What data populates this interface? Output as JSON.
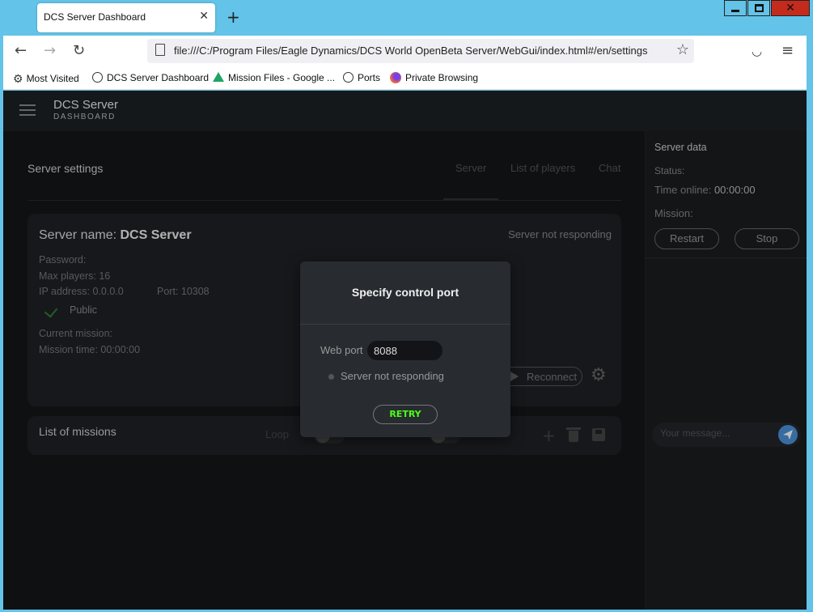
{
  "browser": {
    "tab_title": "DCS Server Dashboard",
    "url": "file:///C:/Program Files/Eagle Dynamics/DCS World OpenBeta Server/WebGui/index.html#/en/settings",
    "bookmarks": [
      "Most Visited",
      "DCS Server Dashboard",
      "Mission Files - Google ...",
      "Ports",
      "Private Browsing"
    ]
  },
  "app": {
    "brand": "DCS Server",
    "brand_sub": "DASHBOARD"
  },
  "main": {
    "title": "Server settings",
    "tabs": [
      "Server",
      "List of players",
      "Chat"
    ]
  },
  "server": {
    "name_label": "Server name:",
    "name": "DCS Server",
    "status": "Server not responding",
    "password": "Password:",
    "max_players": "Max players: 16",
    "ip": "IP address: 0.0.0.0",
    "port": "Port: 10308",
    "public_label": "Public",
    "current_mission": "Current mission:",
    "mission_time": "Mission time: 00:00:00",
    "reconnect": "Reconnect"
  },
  "missions": {
    "title": "List of missions",
    "loop_label": "Loop"
  },
  "right_panel": {
    "title": "Server data",
    "status": "Status:",
    "time_online_label": "Time online:",
    "time_online": "00:00:00",
    "mission": "Mission:",
    "restart": "Restart",
    "stop": "Stop",
    "chat_placeholder": "Your message..."
  },
  "modal": {
    "title": "Specify control port",
    "port_label": "Web port",
    "port_value": "8088",
    "status": "Server not responding",
    "retry": "RETRY"
  },
  "colors": {
    "retry_text": "#4cff1a",
    "send_button": "#4a90d9",
    "window_close": "#c42b1c"
  }
}
